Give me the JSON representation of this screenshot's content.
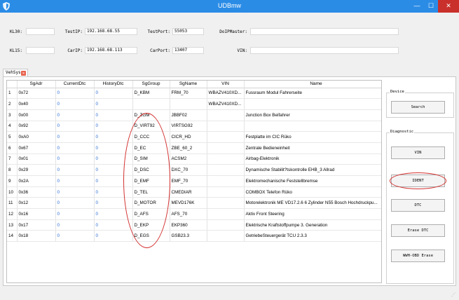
{
  "window": {
    "title": "UDBmw",
    "min_glyph": "—",
    "max_glyph": "☐",
    "close_glyph": "✕"
  },
  "fields": [
    {
      "label": "KL30:",
      "value": ""
    },
    {
      "label": "TestIP:",
      "value": "192.168.68.55"
    },
    {
      "label": "TestPort:",
      "value": "55053"
    },
    {
      "label": "DoIPMaster:",
      "value": ""
    },
    {
      "label": "KL15:",
      "value": ""
    },
    {
      "label": "CarIP:",
      "value": "192.168.68.113"
    },
    {
      "label": "CarPort:",
      "value": "13407"
    },
    {
      "label": "VIN:",
      "value": ""
    }
  ],
  "tab": {
    "label": "VehSys",
    "close_glyph": "✕"
  },
  "grid": {
    "headers": [
      "",
      "SgAdr",
      "CurrentDtc",
      "HistoryDtc",
      "SgGroup",
      "SgName",
      "VIN",
      "Name"
    ],
    "rows": [
      [
        "1",
        "0x72",
        "0",
        "0",
        "D_KBM",
        "FRM_70",
        "WBAZV410XD...",
        "Fussraum Modul Fahrerseite"
      ],
      [
        "2",
        "0x40",
        "0",
        "0",
        "",
        "",
        "WBAZV410XD...",
        ""
      ],
      [
        "3",
        "0x00",
        "0",
        "0",
        "D_ZGM",
        "JBBF02",
        "",
        "Junction Box Beifahrer"
      ],
      [
        "4",
        "0x92",
        "0",
        "0",
        "D_VIRT92",
        "VIRTSG92",
        "",
        ""
      ],
      [
        "5",
        "0xA0",
        "0",
        "0",
        "D_CCC",
        "CICR_HD",
        "",
        "Festplatte im CIC Rüko"
      ],
      [
        "6",
        "0x67",
        "0",
        "0",
        "D_EC",
        "ZBE_60_2",
        "",
        "Zentrale Bedieneinheit"
      ],
      [
        "7",
        "0x01",
        "0",
        "0",
        "D_SIM",
        "ACSM2",
        "",
        "Airbag-Elektronik"
      ],
      [
        "8",
        "0x29",
        "0",
        "0",
        "D_DSC",
        "DXC_70",
        "",
        "Dynamische Stabilit?tskontrolle EHB_3 Allrad"
      ],
      [
        "9",
        "0x2A",
        "0",
        "0",
        "D_EMF",
        "EMF_70",
        "",
        "Elektromechanische Feststellbremse"
      ],
      [
        "10",
        "0x36",
        "0",
        "0",
        "D_TEL",
        "CMEDIAR",
        "",
        "COMBOX Telefon Rüko"
      ],
      [
        "11",
        "0x12",
        "0",
        "0",
        "D_MOTOR",
        "MEVD176K",
        "",
        "Motorelektronik ME VD17.2.6 6 Zylinder N55 Bosch Hochdruckpu..."
      ],
      [
        "12",
        "0x16",
        "0",
        "0",
        "D_AFS",
        "AFS_70",
        "",
        "Aktiv Front Steering"
      ],
      [
        "13",
        "0x17",
        "0",
        "0",
        "D_EKP",
        "EKP360",
        "",
        "Elektrische Kraftstoffpumpe 3. Generation"
      ],
      [
        "14",
        "0x18",
        "0",
        "0",
        "D_EGS",
        "GSB23.3",
        "",
        "GetriebeSteuergerät TCU 2.3.3"
      ]
    ]
  },
  "device": {
    "title": "Device",
    "search_label": "Search"
  },
  "diagnostic": {
    "title": "Diagnostic",
    "buttons": [
      "VIN",
      "IDENT",
      "DTC",
      "Erase DTC",
      "WWH-OBD Erase"
    ]
  },
  "colors": {
    "titlebar": "#2b8ce6",
    "dtc_value": "#2e6fd6",
    "annotation": "#d33030"
  }
}
